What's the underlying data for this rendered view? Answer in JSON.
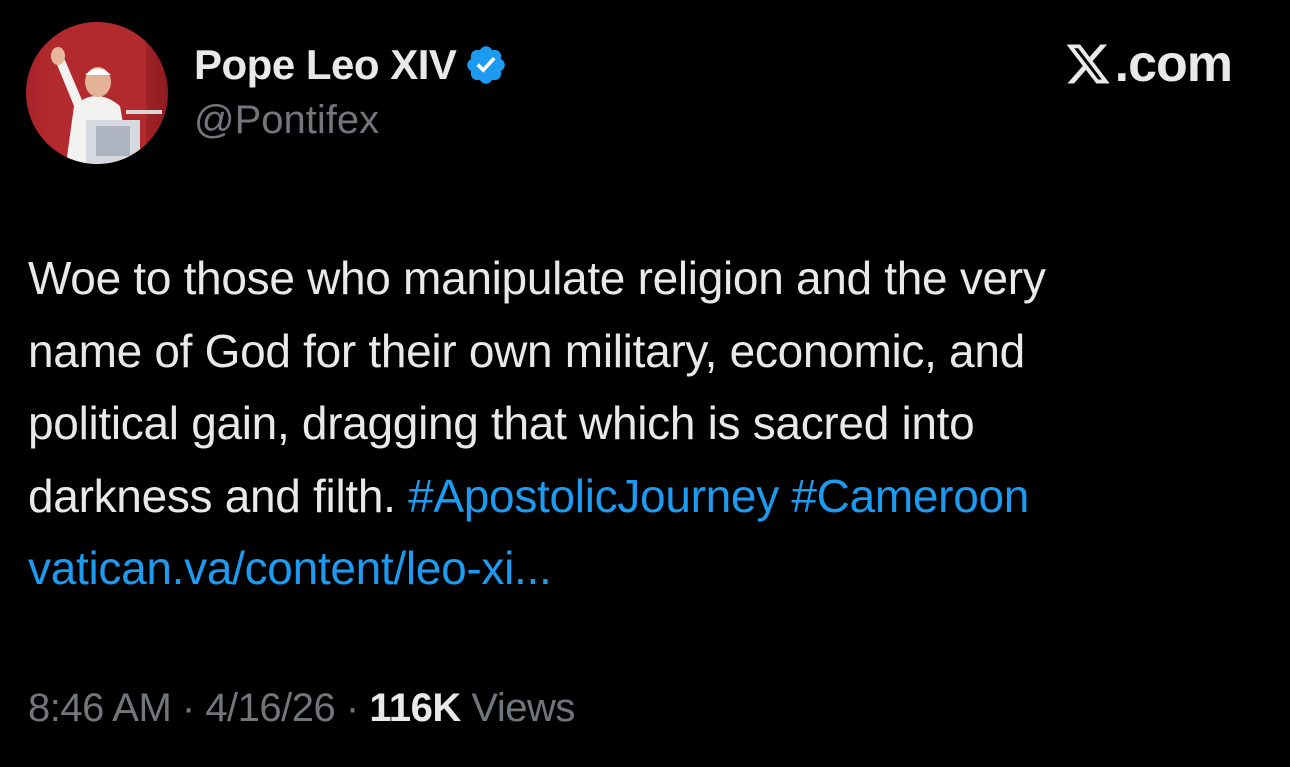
{
  "author": {
    "display_name": "Pope Leo XIV",
    "handle": "@Pontifex",
    "verified_icon": "verified-badge-icon",
    "verified_color": "#1d9bf0"
  },
  "brand": {
    "text": ".com",
    "icon": "x-logo-icon"
  },
  "tweet": {
    "line1": "Woe to those who manipulate religion and the very",
    "line2": "name of God for their own military, economic, and",
    "line3": "political gain, dragging that which is sacred into",
    "line4_text": "darkness and filth. ",
    "hashtag1": "#ApostolicJourney",
    "hashtag2": "#Cameroon",
    "link": "vatican.va/content/leo-xi..."
  },
  "meta": {
    "time": "8:46 AM",
    "sep1": " · ",
    "date": "4/16/26",
    "sep2": " · ",
    "views_count": "116K",
    "views_label": " Views"
  },
  "colors": {
    "background": "#000000",
    "text": "#e7e9ea",
    "muted": "#71767b",
    "accent": "#1d9bf0"
  }
}
